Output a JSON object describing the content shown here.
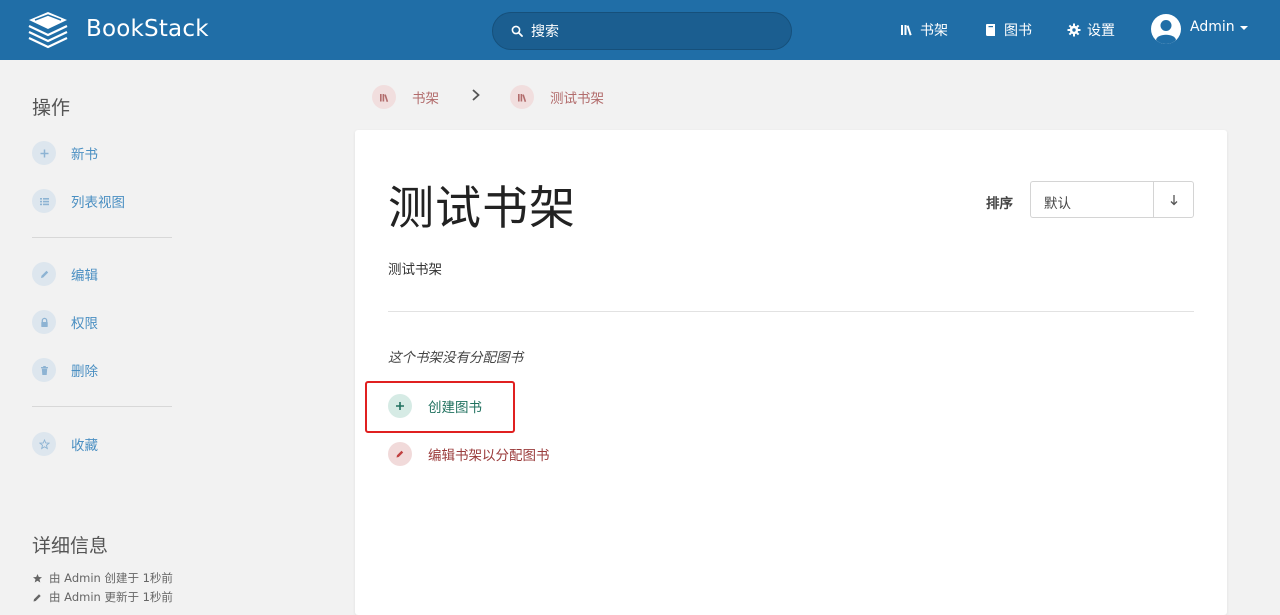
{
  "header": {
    "brand": "BookStack",
    "search_placeholder": "搜索",
    "nav": [
      {
        "label": "书架",
        "icon": "shelves-icon"
      },
      {
        "label": "图书",
        "icon": "book-icon"
      },
      {
        "label": "设置",
        "icon": "gear-icon"
      }
    ],
    "user": "Admin"
  },
  "sidebar": {
    "actions_heading": "操作",
    "groups": [
      [
        {
          "label": "新书",
          "icon": "plus-icon"
        },
        {
          "label": "列表视图",
          "icon": "list-icon"
        }
      ],
      [
        {
          "label": "编辑",
          "icon": "pencil-icon"
        },
        {
          "label": "权限",
          "icon": "lock-icon"
        },
        {
          "label": "删除",
          "icon": "trash-icon"
        }
      ],
      [
        {
          "label": "收藏",
          "icon": "star-icon"
        }
      ]
    ],
    "details_heading": "详细信息",
    "meta": [
      {
        "text": "由 Admin 创建于 1秒前",
        "icon": "star-icon"
      },
      {
        "text": "由 Admin 更新于 1秒前",
        "icon": "pencil-icon"
      }
    ]
  },
  "breadcrumb": [
    {
      "label": "书架",
      "icon": "shelves-icon"
    },
    {
      "label": "测试书架",
      "icon": "shelves-icon"
    }
  ],
  "main": {
    "title": "测试书架",
    "sort_label": "排序",
    "sort_value": "默认",
    "description": "测试书架",
    "empty_message": "这个书架没有分配图书",
    "create_book_label": "创建图书",
    "edit_shelf_label": "编辑书架以分配图书"
  },
  "colors": {
    "header_bg": "#206ea7",
    "sidebar_link": "#4a8fc2",
    "breadcrumb_link": "#b26c6c",
    "create_link": "#20715f",
    "edit_link": "#9a3b3b",
    "highlight_border": "#e02020"
  }
}
